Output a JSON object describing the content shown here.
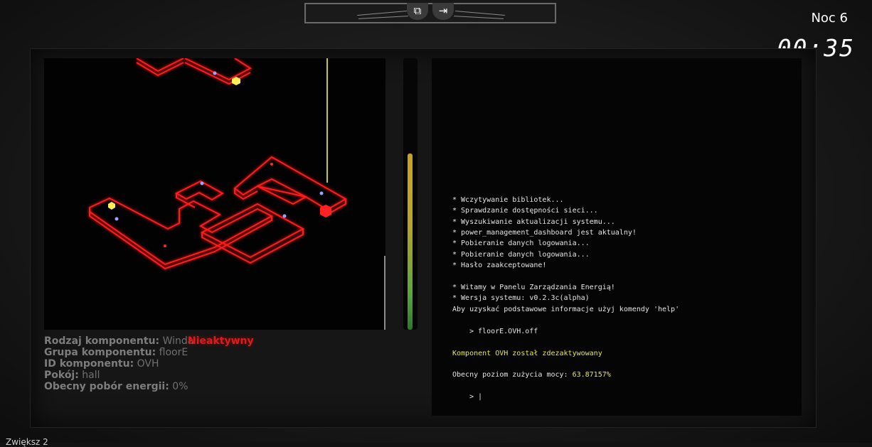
{
  "top_bar": {
    "left_icon": "copy-window-icon",
    "right_icon": "exit-icon"
  },
  "clock": {
    "night_label": "Noc 6",
    "time": "00:35"
  },
  "component_info": {
    "type_label": "Rodzaj komponentu:",
    "type_value": "Winda",
    "group_label": "Grupa komponentu:",
    "group_value": "floorE",
    "id_label": "ID komponentu:",
    "id_value": "OVH",
    "room_label": "Pokój:",
    "room_value": "hall",
    "power_label": "Obecny pobór energii:",
    "power_value": "0%",
    "status": "Nieaktywny"
  },
  "power_meter": {
    "level_fraction": 0.65
  },
  "terminal": {
    "lines": [
      "* Wczytywanie bibliotek...",
      "* Sprawdzanie dostępności sieci...",
      "* Wyszukiwanie aktualizacji systemu...",
      "* power_management_dashboard jest aktualny!",
      "* Pobieranie danych logowania...",
      "* Pobieranie danych logowania...",
      "* Hasło zaakceptowane!",
      "* Witamy w Panelu Zarządzania Energią!",
      "* Wersja systemu: v0.2.3c(alpha)",
      "Aby uzyskać podstawowe informacje użyj komendy 'help'"
    ],
    "command": "> floorE.OVH.off",
    "result": "Komponent OVH został zdezaktywowany",
    "usage_prefix": "Obecny poziom zużycia mocy: ",
    "usage_value": "63.87157%",
    "prompt": "> |"
  },
  "footer": {
    "text": "Zwiększ 2"
  },
  "colors": {
    "map_line": "#ff1a1a",
    "status_inactive": "#e01b1b",
    "terminal_highlight": "#e9e94a"
  }
}
